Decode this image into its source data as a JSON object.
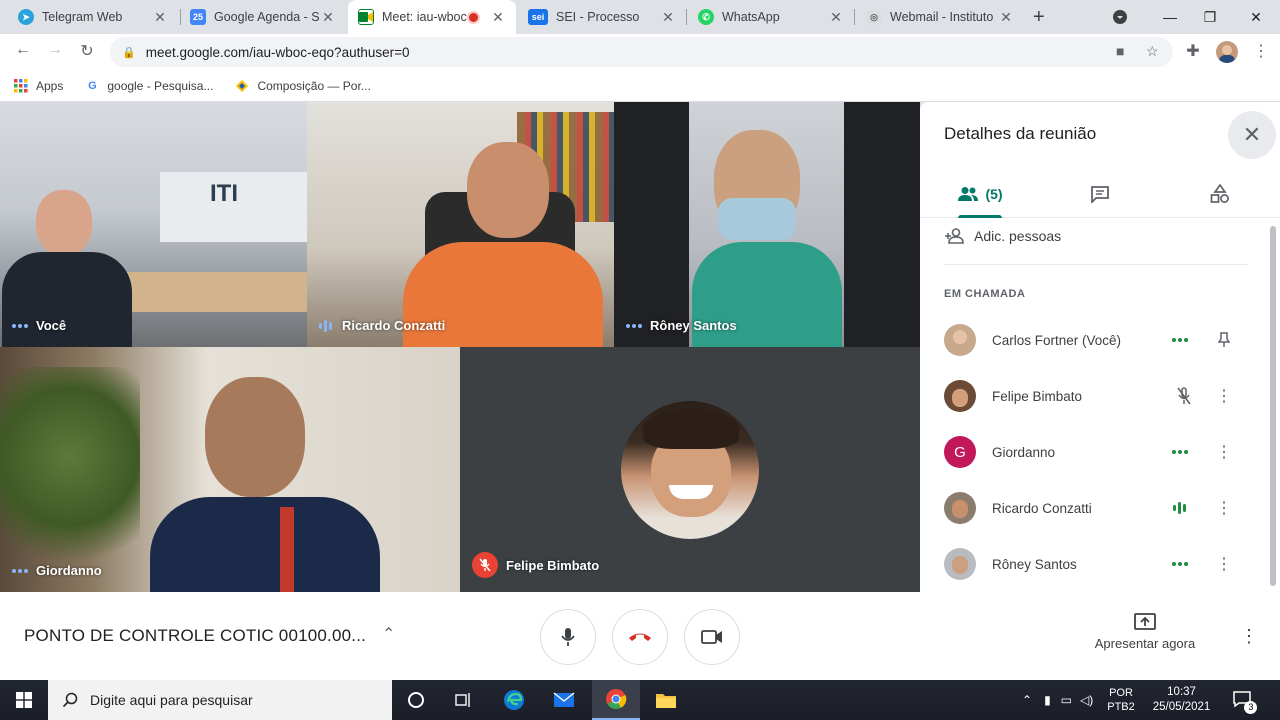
{
  "browser": {
    "tabs": [
      {
        "title": "Telegram Web",
        "icon": "telegram-icon",
        "color": "#2aa3dc"
      },
      {
        "title": "Google Agenda - S",
        "icon": "calendar-icon",
        "color": "#4285f4"
      },
      {
        "title": "Meet: iau-wboc",
        "icon": "meet-icon",
        "color": "#00832d",
        "active": true
      },
      {
        "title": "SEI - Processo",
        "icon": "sei-icon",
        "color": "#1a73e8"
      },
      {
        "title": "WhatsApp",
        "icon": "whatsapp-icon",
        "color": "#25d366"
      },
      {
        "title": "Webmail - Instituto",
        "icon": "webmail-icon",
        "color": "#9aa0a6"
      }
    ],
    "url": "meet.google.com/iau-wboc-eqo?authuser=0",
    "bookmarks": [
      {
        "label": "Apps",
        "icon": "apps-grid-icon"
      },
      {
        "label": "google - Pesquisa...",
        "icon": "google-icon"
      },
      {
        "label": "Composição — Por...",
        "icon": "bookmark-site-icon"
      }
    ]
  },
  "meet": {
    "tiles": [
      {
        "name": "Você",
        "indicator": "dots"
      },
      {
        "name": "Ricardo Conzatti",
        "indicator": "bars"
      },
      {
        "name": "Rôney Santos",
        "indicator": "dots"
      },
      {
        "name": "Giordanno",
        "indicator": "dots"
      },
      {
        "name": "Felipe Bimbato",
        "indicator": "muted"
      }
    ],
    "meeting_title": "PONTO DE CONTROLE COTIC 00100.00...",
    "present_label": "Apresentar agora"
  },
  "panel": {
    "title": "Detalhes da reunião",
    "people_count": "(5)",
    "add_people": "Adic. pessoas",
    "section": "EM CHAMADA",
    "participants": [
      {
        "name": "Carlos Fortner (Você)",
        "status": "dots",
        "action": "pin"
      },
      {
        "name": "Felipe Bimbato",
        "status": "mic-off",
        "action": "more"
      },
      {
        "name": "Giordanno",
        "status": "dots",
        "action": "more",
        "initial": "G",
        "color": "#c2185b"
      },
      {
        "name": "Ricardo Conzatti",
        "status": "bars",
        "action": "more"
      },
      {
        "name": "Rôney Santos",
        "status": "dots",
        "action": "more"
      }
    ]
  },
  "taskbar": {
    "search_placeholder": "Digite aqui para pesquisar",
    "lang": "POR",
    "layout": "PTB2",
    "time": "10:37",
    "date": "25/05/2021",
    "notifications": "3"
  }
}
